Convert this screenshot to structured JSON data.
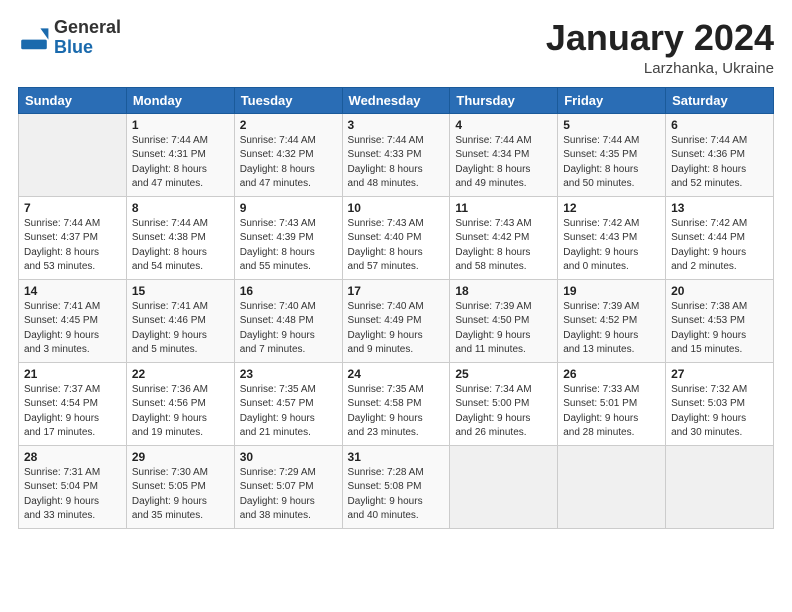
{
  "header": {
    "logo_general": "General",
    "logo_blue": "Blue",
    "title": "January 2024",
    "subtitle": "Larzhanka, Ukraine"
  },
  "weekdays": [
    "Sunday",
    "Monday",
    "Tuesday",
    "Wednesday",
    "Thursday",
    "Friday",
    "Saturday"
  ],
  "weeks": [
    [
      {
        "day": "",
        "info": ""
      },
      {
        "day": "1",
        "info": "Sunrise: 7:44 AM\nSunset: 4:31 PM\nDaylight: 8 hours\nand 47 minutes."
      },
      {
        "day": "2",
        "info": "Sunrise: 7:44 AM\nSunset: 4:32 PM\nDaylight: 8 hours\nand 47 minutes."
      },
      {
        "day": "3",
        "info": "Sunrise: 7:44 AM\nSunset: 4:33 PM\nDaylight: 8 hours\nand 48 minutes."
      },
      {
        "day": "4",
        "info": "Sunrise: 7:44 AM\nSunset: 4:34 PM\nDaylight: 8 hours\nand 49 minutes."
      },
      {
        "day": "5",
        "info": "Sunrise: 7:44 AM\nSunset: 4:35 PM\nDaylight: 8 hours\nand 50 minutes."
      },
      {
        "day": "6",
        "info": "Sunrise: 7:44 AM\nSunset: 4:36 PM\nDaylight: 8 hours\nand 52 minutes."
      }
    ],
    [
      {
        "day": "7",
        "info": "Sunrise: 7:44 AM\nSunset: 4:37 PM\nDaylight: 8 hours\nand 53 minutes."
      },
      {
        "day": "8",
        "info": "Sunrise: 7:44 AM\nSunset: 4:38 PM\nDaylight: 8 hours\nand 54 minutes."
      },
      {
        "day": "9",
        "info": "Sunrise: 7:43 AM\nSunset: 4:39 PM\nDaylight: 8 hours\nand 55 minutes."
      },
      {
        "day": "10",
        "info": "Sunrise: 7:43 AM\nSunset: 4:40 PM\nDaylight: 8 hours\nand 57 minutes."
      },
      {
        "day": "11",
        "info": "Sunrise: 7:43 AM\nSunset: 4:42 PM\nDaylight: 8 hours\nand 58 minutes."
      },
      {
        "day": "12",
        "info": "Sunrise: 7:42 AM\nSunset: 4:43 PM\nDaylight: 9 hours\nand 0 minutes."
      },
      {
        "day": "13",
        "info": "Sunrise: 7:42 AM\nSunset: 4:44 PM\nDaylight: 9 hours\nand 2 minutes."
      }
    ],
    [
      {
        "day": "14",
        "info": "Sunrise: 7:41 AM\nSunset: 4:45 PM\nDaylight: 9 hours\nand 3 minutes."
      },
      {
        "day": "15",
        "info": "Sunrise: 7:41 AM\nSunset: 4:46 PM\nDaylight: 9 hours\nand 5 minutes."
      },
      {
        "day": "16",
        "info": "Sunrise: 7:40 AM\nSunset: 4:48 PM\nDaylight: 9 hours\nand 7 minutes."
      },
      {
        "day": "17",
        "info": "Sunrise: 7:40 AM\nSunset: 4:49 PM\nDaylight: 9 hours\nand 9 minutes."
      },
      {
        "day": "18",
        "info": "Sunrise: 7:39 AM\nSunset: 4:50 PM\nDaylight: 9 hours\nand 11 minutes."
      },
      {
        "day": "19",
        "info": "Sunrise: 7:39 AM\nSunset: 4:52 PM\nDaylight: 9 hours\nand 13 minutes."
      },
      {
        "day": "20",
        "info": "Sunrise: 7:38 AM\nSunset: 4:53 PM\nDaylight: 9 hours\nand 15 minutes."
      }
    ],
    [
      {
        "day": "21",
        "info": "Sunrise: 7:37 AM\nSunset: 4:54 PM\nDaylight: 9 hours\nand 17 minutes."
      },
      {
        "day": "22",
        "info": "Sunrise: 7:36 AM\nSunset: 4:56 PM\nDaylight: 9 hours\nand 19 minutes."
      },
      {
        "day": "23",
        "info": "Sunrise: 7:35 AM\nSunset: 4:57 PM\nDaylight: 9 hours\nand 21 minutes."
      },
      {
        "day": "24",
        "info": "Sunrise: 7:35 AM\nSunset: 4:58 PM\nDaylight: 9 hours\nand 23 minutes."
      },
      {
        "day": "25",
        "info": "Sunrise: 7:34 AM\nSunset: 5:00 PM\nDaylight: 9 hours\nand 26 minutes."
      },
      {
        "day": "26",
        "info": "Sunrise: 7:33 AM\nSunset: 5:01 PM\nDaylight: 9 hours\nand 28 minutes."
      },
      {
        "day": "27",
        "info": "Sunrise: 7:32 AM\nSunset: 5:03 PM\nDaylight: 9 hours\nand 30 minutes."
      }
    ],
    [
      {
        "day": "28",
        "info": "Sunrise: 7:31 AM\nSunset: 5:04 PM\nDaylight: 9 hours\nand 33 minutes."
      },
      {
        "day": "29",
        "info": "Sunrise: 7:30 AM\nSunset: 5:05 PM\nDaylight: 9 hours\nand 35 minutes."
      },
      {
        "day": "30",
        "info": "Sunrise: 7:29 AM\nSunset: 5:07 PM\nDaylight: 9 hours\nand 38 minutes."
      },
      {
        "day": "31",
        "info": "Sunrise: 7:28 AM\nSunset: 5:08 PM\nDaylight: 9 hours\nand 40 minutes."
      },
      {
        "day": "",
        "info": ""
      },
      {
        "day": "",
        "info": ""
      },
      {
        "day": "",
        "info": ""
      }
    ]
  ]
}
